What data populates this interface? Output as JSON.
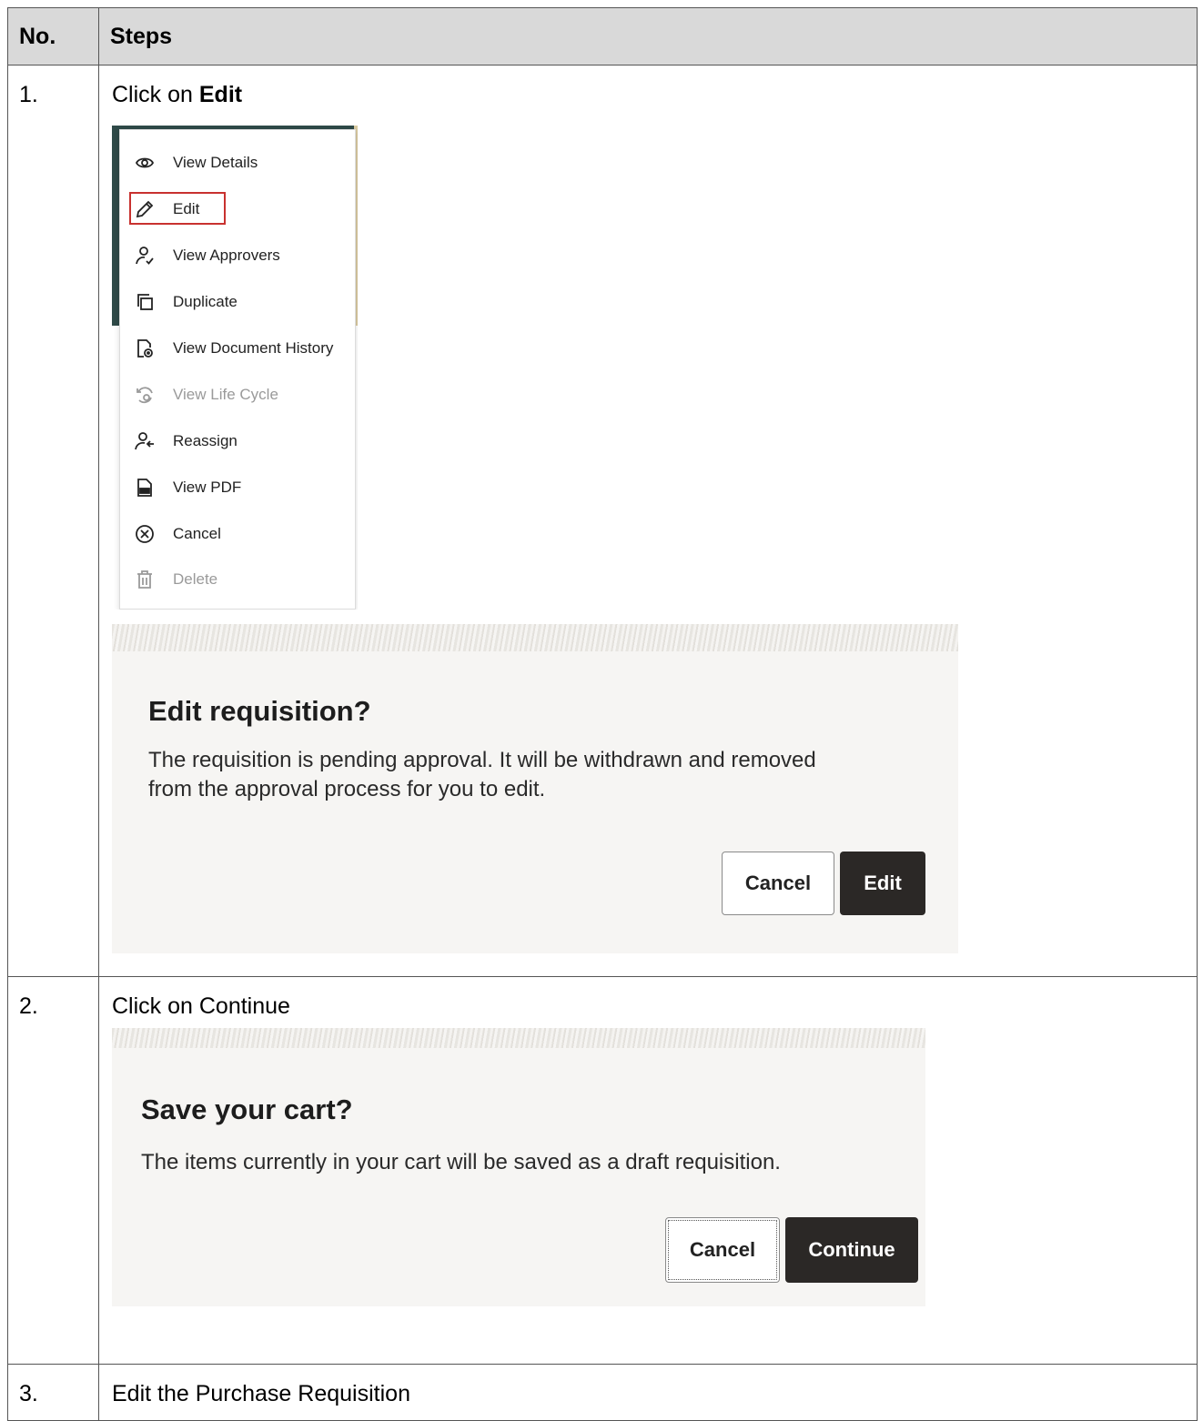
{
  "table": {
    "headers": {
      "no": "No.",
      "steps": "Steps"
    },
    "rows": [
      {
        "no": "1.",
        "text_prefix": "Click on ",
        "text_bold": "Edit"
      },
      {
        "no": "2.",
        "text": "Click on Continue"
      },
      {
        "no": "3.",
        "text": "Edit the Purchase Requisition"
      }
    ]
  },
  "actions_menu": {
    "items": [
      {
        "label": "View Details",
        "icon": "eye-icon",
        "enabled": true
      },
      {
        "label": "Edit",
        "icon": "pencil-icon",
        "enabled": true,
        "highlighted": true
      },
      {
        "label": "View Approvers",
        "icon": "user-check-icon",
        "enabled": true
      },
      {
        "label": "Duplicate",
        "icon": "copy-icon",
        "enabled": true
      },
      {
        "label": "View Document History",
        "icon": "document-history-icon",
        "enabled": true
      },
      {
        "label": "View Life Cycle",
        "icon": "life-cycle-icon",
        "enabled": false
      },
      {
        "label": "Reassign",
        "icon": "user-reassign-icon",
        "enabled": true
      },
      {
        "label": "View PDF",
        "icon": "pdf-icon",
        "enabled": true
      },
      {
        "label": "Cancel",
        "icon": "cancel-circle-icon",
        "enabled": true
      },
      {
        "label": "Delete",
        "icon": "trash-icon",
        "enabled": false
      }
    ],
    "highlight_color": "#c8312f"
  },
  "edit_dialog": {
    "title": "Edit requisition?",
    "message_line1": "The requisition is pending approval. It will be withdrawn and removed",
    "message_line2": "from the approval process for you to edit.",
    "cancel_label": "Cancel",
    "confirm_label": "Edit"
  },
  "save_dialog": {
    "title": "Save your cart?",
    "message": "The items currently in your cart will be saved as a draft requisition.",
    "cancel_label": "Cancel",
    "confirm_label": "Continue"
  },
  "colors": {
    "header_bg": "#d9d9d9",
    "dialog_bg": "#f6f5f3",
    "primary_button": "#2b2826"
  }
}
